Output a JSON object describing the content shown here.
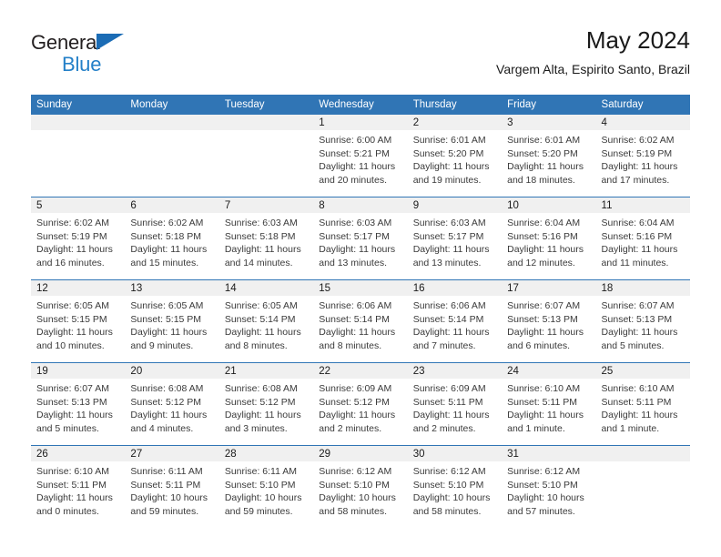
{
  "brand": {
    "name_part1": "General",
    "name_part2": "Blue",
    "accent_color": "#2480c8",
    "triangle_color": "#1b6cb5"
  },
  "header": {
    "title": "May 2024",
    "subtitle": "Vargem Alta, Espirito Santo, Brazil"
  },
  "theme": {
    "header_bg": "#3075b5",
    "daynum_bg": "#f0f0f0",
    "row_divider": "#3075b5"
  },
  "weekdays": [
    "Sunday",
    "Monday",
    "Tuesday",
    "Wednesday",
    "Thursday",
    "Friday",
    "Saturday"
  ],
  "weeks": [
    [
      {
        "day": "",
        "sunrise": "",
        "sunset": "",
        "daylight1": "",
        "daylight2": ""
      },
      {
        "day": "",
        "sunrise": "",
        "sunset": "",
        "daylight1": "",
        "daylight2": ""
      },
      {
        "day": "",
        "sunrise": "",
        "sunset": "",
        "daylight1": "",
        "daylight2": ""
      },
      {
        "day": "1",
        "sunrise": "Sunrise: 6:00 AM",
        "sunset": "Sunset: 5:21 PM",
        "daylight1": "Daylight: 11 hours",
        "daylight2": "and 20 minutes."
      },
      {
        "day": "2",
        "sunrise": "Sunrise: 6:01 AM",
        "sunset": "Sunset: 5:20 PM",
        "daylight1": "Daylight: 11 hours",
        "daylight2": "and 19 minutes."
      },
      {
        "day": "3",
        "sunrise": "Sunrise: 6:01 AM",
        "sunset": "Sunset: 5:20 PM",
        "daylight1": "Daylight: 11 hours",
        "daylight2": "and 18 minutes."
      },
      {
        "day": "4",
        "sunrise": "Sunrise: 6:02 AM",
        "sunset": "Sunset: 5:19 PM",
        "daylight1": "Daylight: 11 hours",
        "daylight2": "and 17 minutes."
      }
    ],
    [
      {
        "day": "5",
        "sunrise": "Sunrise: 6:02 AM",
        "sunset": "Sunset: 5:19 PM",
        "daylight1": "Daylight: 11 hours",
        "daylight2": "and 16 minutes."
      },
      {
        "day": "6",
        "sunrise": "Sunrise: 6:02 AM",
        "sunset": "Sunset: 5:18 PM",
        "daylight1": "Daylight: 11 hours",
        "daylight2": "and 15 minutes."
      },
      {
        "day": "7",
        "sunrise": "Sunrise: 6:03 AM",
        "sunset": "Sunset: 5:18 PM",
        "daylight1": "Daylight: 11 hours",
        "daylight2": "and 14 minutes."
      },
      {
        "day": "8",
        "sunrise": "Sunrise: 6:03 AM",
        "sunset": "Sunset: 5:17 PM",
        "daylight1": "Daylight: 11 hours",
        "daylight2": "and 13 minutes."
      },
      {
        "day": "9",
        "sunrise": "Sunrise: 6:03 AM",
        "sunset": "Sunset: 5:17 PM",
        "daylight1": "Daylight: 11 hours",
        "daylight2": "and 13 minutes."
      },
      {
        "day": "10",
        "sunrise": "Sunrise: 6:04 AM",
        "sunset": "Sunset: 5:16 PM",
        "daylight1": "Daylight: 11 hours",
        "daylight2": "and 12 minutes."
      },
      {
        "day": "11",
        "sunrise": "Sunrise: 6:04 AM",
        "sunset": "Sunset: 5:16 PM",
        "daylight1": "Daylight: 11 hours",
        "daylight2": "and 11 minutes."
      }
    ],
    [
      {
        "day": "12",
        "sunrise": "Sunrise: 6:05 AM",
        "sunset": "Sunset: 5:15 PM",
        "daylight1": "Daylight: 11 hours",
        "daylight2": "and 10 minutes."
      },
      {
        "day": "13",
        "sunrise": "Sunrise: 6:05 AM",
        "sunset": "Sunset: 5:15 PM",
        "daylight1": "Daylight: 11 hours",
        "daylight2": "and 9 minutes."
      },
      {
        "day": "14",
        "sunrise": "Sunrise: 6:05 AM",
        "sunset": "Sunset: 5:14 PM",
        "daylight1": "Daylight: 11 hours",
        "daylight2": "and 8 minutes."
      },
      {
        "day": "15",
        "sunrise": "Sunrise: 6:06 AM",
        "sunset": "Sunset: 5:14 PM",
        "daylight1": "Daylight: 11 hours",
        "daylight2": "and 8 minutes."
      },
      {
        "day": "16",
        "sunrise": "Sunrise: 6:06 AM",
        "sunset": "Sunset: 5:14 PM",
        "daylight1": "Daylight: 11 hours",
        "daylight2": "and 7 minutes."
      },
      {
        "day": "17",
        "sunrise": "Sunrise: 6:07 AM",
        "sunset": "Sunset: 5:13 PM",
        "daylight1": "Daylight: 11 hours",
        "daylight2": "and 6 minutes."
      },
      {
        "day": "18",
        "sunrise": "Sunrise: 6:07 AM",
        "sunset": "Sunset: 5:13 PM",
        "daylight1": "Daylight: 11 hours",
        "daylight2": "and 5 minutes."
      }
    ],
    [
      {
        "day": "19",
        "sunrise": "Sunrise: 6:07 AM",
        "sunset": "Sunset: 5:13 PM",
        "daylight1": "Daylight: 11 hours",
        "daylight2": "and 5 minutes."
      },
      {
        "day": "20",
        "sunrise": "Sunrise: 6:08 AM",
        "sunset": "Sunset: 5:12 PM",
        "daylight1": "Daylight: 11 hours",
        "daylight2": "and 4 minutes."
      },
      {
        "day": "21",
        "sunrise": "Sunrise: 6:08 AM",
        "sunset": "Sunset: 5:12 PM",
        "daylight1": "Daylight: 11 hours",
        "daylight2": "and 3 minutes."
      },
      {
        "day": "22",
        "sunrise": "Sunrise: 6:09 AM",
        "sunset": "Sunset: 5:12 PM",
        "daylight1": "Daylight: 11 hours",
        "daylight2": "and 2 minutes."
      },
      {
        "day": "23",
        "sunrise": "Sunrise: 6:09 AM",
        "sunset": "Sunset: 5:11 PM",
        "daylight1": "Daylight: 11 hours",
        "daylight2": "and 2 minutes."
      },
      {
        "day": "24",
        "sunrise": "Sunrise: 6:10 AM",
        "sunset": "Sunset: 5:11 PM",
        "daylight1": "Daylight: 11 hours",
        "daylight2": "and 1 minute."
      },
      {
        "day": "25",
        "sunrise": "Sunrise: 6:10 AM",
        "sunset": "Sunset: 5:11 PM",
        "daylight1": "Daylight: 11 hours",
        "daylight2": "and 1 minute."
      }
    ],
    [
      {
        "day": "26",
        "sunrise": "Sunrise: 6:10 AM",
        "sunset": "Sunset: 5:11 PM",
        "daylight1": "Daylight: 11 hours",
        "daylight2": "and 0 minutes."
      },
      {
        "day": "27",
        "sunrise": "Sunrise: 6:11 AM",
        "sunset": "Sunset: 5:11 PM",
        "daylight1": "Daylight: 10 hours",
        "daylight2": "and 59 minutes."
      },
      {
        "day": "28",
        "sunrise": "Sunrise: 6:11 AM",
        "sunset": "Sunset: 5:10 PM",
        "daylight1": "Daylight: 10 hours",
        "daylight2": "and 59 minutes."
      },
      {
        "day": "29",
        "sunrise": "Sunrise: 6:12 AM",
        "sunset": "Sunset: 5:10 PM",
        "daylight1": "Daylight: 10 hours",
        "daylight2": "and 58 minutes."
      },
      {
        "day": "30",
        "sunrise": "Sunrise: 6:12 AM",
        "sunset": "Sunset: 5:10 PM",
        "daylight1": "Daylight: 10 hours",
        "daylight2": "and 58 minutes."
      },
      {
        "day": "31",
        "sunrise": "Sunrise: 6:12 AM",
        "sunset": "Sunset: 5:10 PM",
        "daylight1": "Daylight: 10 hours",
        "daylight2": "and 57 minutes."
      },
      {
        "day": "",
        "sunrise": "",
        "sunset": "",
        "daylight1": "",
        "daylight2": ""
      }
    ]
  ]
}
